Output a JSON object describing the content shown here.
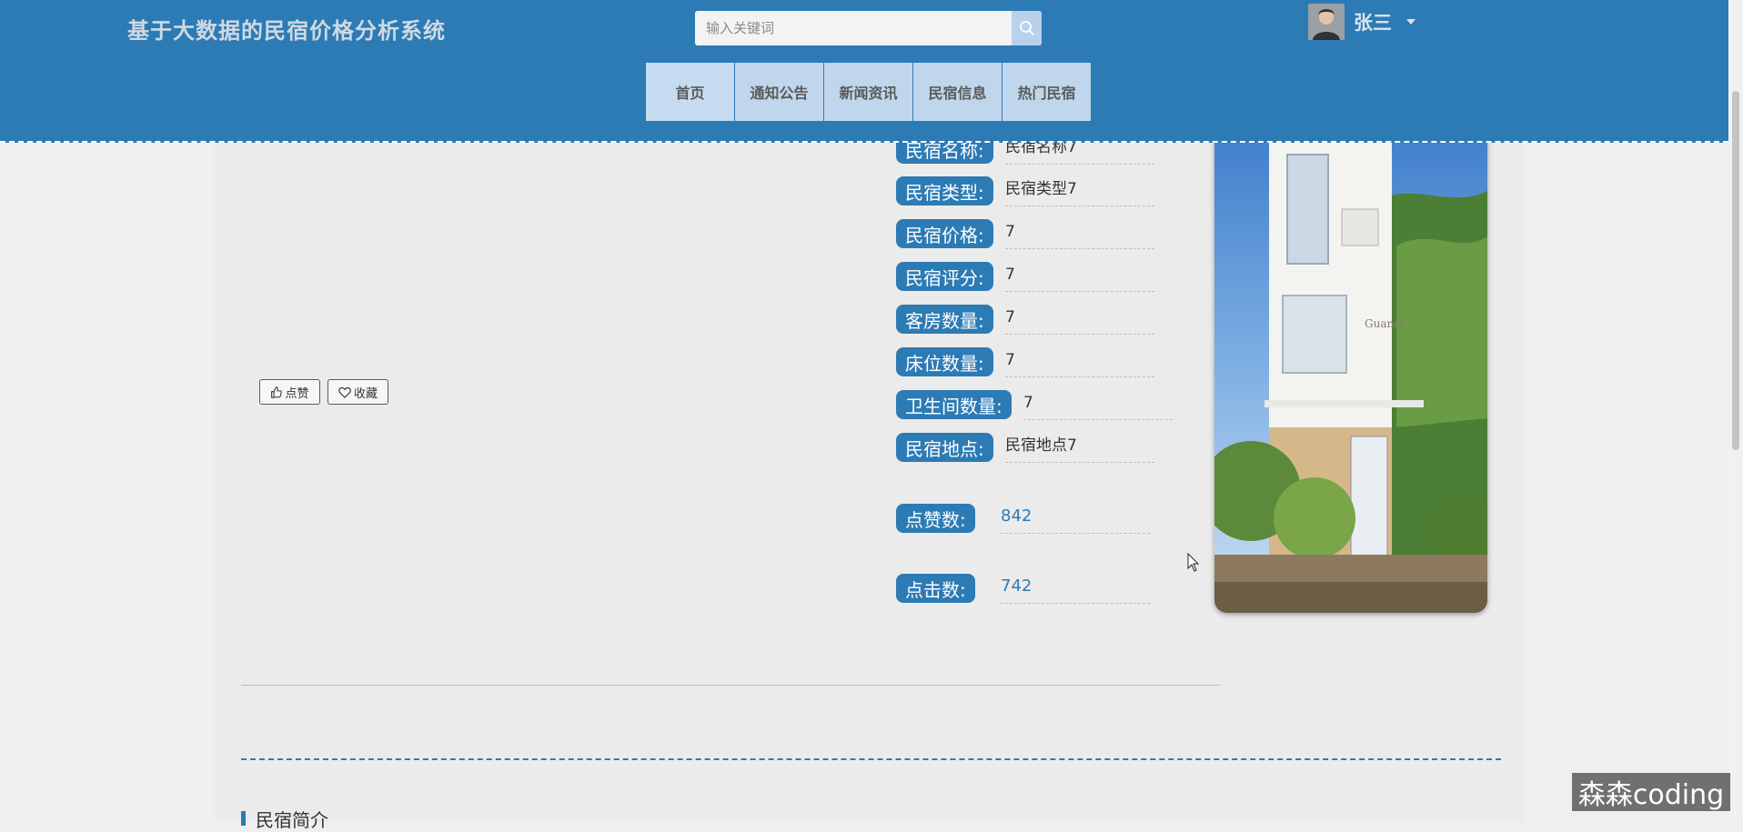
{
  "header": {
    "site_title": "基于大数据的民宿价格分析系统",
    "search_placeholder": "输入关键词",
    "username": "张三",
    "nav": [
      "首页",
      "通知公告",
      "新闻资讯",
      "民宿信息",
      "热门民宿"
    ]
  },
  "actions": {
    "like_label": "点赞",
    "favorite_label": "收藏"
  },
  "details": {
    "fields": [
      {
        "label": "民宿名称:",
        "value": "民宿名称7"
      },
      {
        "label": "民宿类型:",
        "value": "民宿类型7"
      },
      {
        "label": "民宿价格:",
        "value": "7"
      },
      {
        "label": "民宿评分:",
        "value": "7"
      },
      {
        "label": "客房数量:",
        "value": "7"
      },
      {
        "label": "床位数量:",
        "value": "7"
      },
      {
        "label": "卫生间数量:",
        "value": "7"
      },
      {
        "label": "民宿地点:",
        "value": "民宿地点7"
      }
    ],
    "likes": {
      "label": "点赞数:",
      "value": "842"
    },
    "clicks": {
      "label": "点击数:",
      "value": "742"
    }
  },
  "section": {
    "title": "民宿简介"
  },
  "watermark": "森森coding",
  "colors": {
    "primary": "#2d7bb5",
    "nav_bg": "#bfd6ec",
    "page_bg": "#ebebeb"
  },
  "icons": {
    "search": "search-icon",
    "like": "thumbs-up-icon",
    "favorite": "heart-icon",
    "caret": "caret-down-icon"
  }
}
